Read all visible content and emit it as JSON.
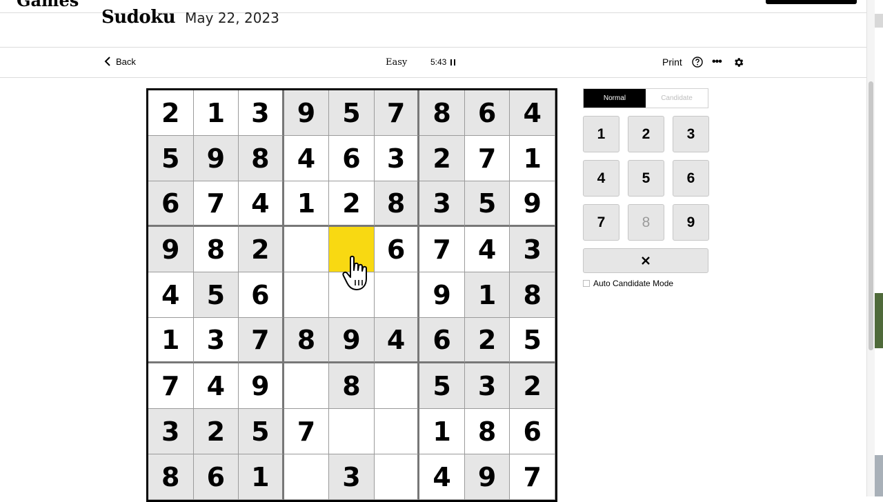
{
  "header": {
    "logo": "Games",
    "title": "Sudoku",
    "date": "May 22, 2023"
  },
  "toolbar": {
    "back_label": "Back",
    "level": "Easy",
    "timer": "5:43",
    "print_label": "Print"
  },
  "board": {
    "rows": [
      [
        "2",
        "1",
        "3",
        "9",
        "5",
        "7",
        "8",
        "6",
        "4"
      ],
      [
        "5",
        "9",
        "8",
        "4",
        "6",
        "3",
        "2",
        "7",
        "1"
      ],
      [
        "6",
        "7",
        "4",
        "1",
        "2",
        "8",
        "3",
        "5",
        "9"
      ],
      [
        "9",
        "8",
        "2",
        "",
        "",
        "6",
        "7",
        "4",
        "3"
      ],
      [
        "4",
        "5",
        "6",
        "",
        "",
        "",
        "9",
        "1",
        "8"
      ],
      [
        "1",
        "3",
        "7",
        "8",
        "9",
        "4",
        "6",
        "2",
        "5"
      ],
      [
        "7",
        "4",
        "9",
        "",
        "8",
        "",
        "5",
        "3",
        "2"
      ],
      [
        "3",
        "2",
        "5",
        "7",
        "",
        "",
        "1",
        "8",
        "6"
      ],
      [
        "8",
        "6",
        "1",
        "",
        "3",
        "",
        "4",
        "9",
        "7"
      ]
    ],
    "shade": [
      "wwwgggggg",
      "gggwwwgww",
      "gwwwwgggw",
      "gwgwywwwg",
      "wgwwwwwgg",
      "wwggggggw",
      "wwwwgwggg",
      "gggwwwwww",
      "gggwgwwgw"
    ],
    "selected_cell": [
      3,
      4
    ]
  },
  "mode": {
    "normal_label": "Normal",
    "candidate_label": "Candidate",
    "active": "Normal"
  },
  "keypad": {
    "keys": [
      "1",
      "2",
      "3",
      "4",
      "5",
      "6",
      "7",
      "8",
      "9"
    ],
    "disabled": [
      "8"
    ]
  },
  "erase": {
    "icon": "close-icon"
  },
  "auto_candidate": {
    "label": "Auto Candidate Mode",
    "checked": false
  },
  "colors": {
    "selected": "#f8d912",
    "given": "#e6e6e6",
    "empty": "#ffffff"
  }
}
